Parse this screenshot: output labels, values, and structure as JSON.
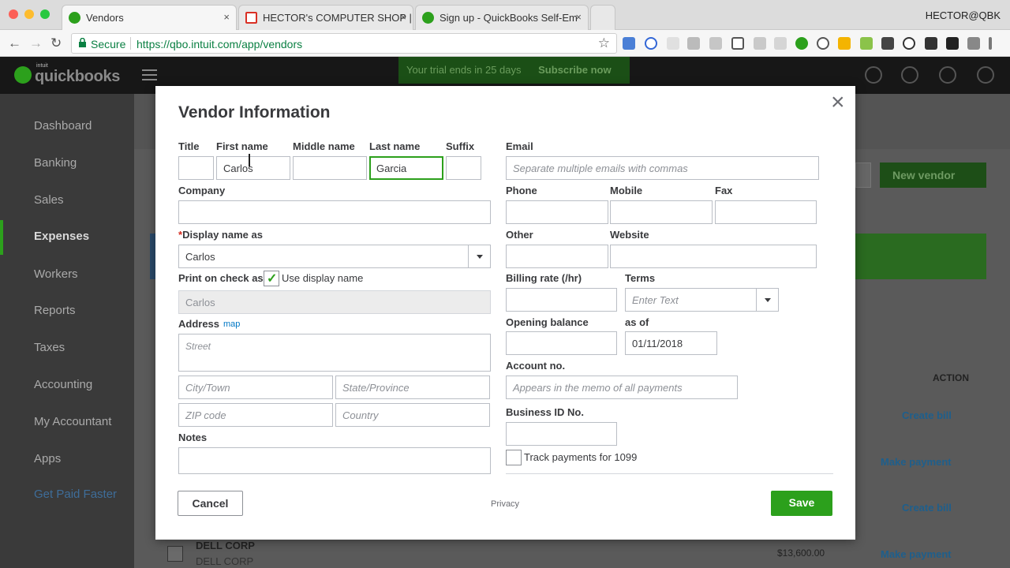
{
  "browser": {
    "tabs": [
      {
        "label": "Vendors",
        "favicon_color": "#2ca01c"
      },
      {
        "label": "HECTOR's COMPUTER SHOP |",
        "favicon_color": "#d93025"
      },
      {
        "label": "Sign up - QuickBooks Self-Em",
        "favicon_color": "#2ca01c"
      }
    ],
    "tab_close": "×",
    "user": "HECTOR@QBK",
    "secure_label": "Secure",
    "url": "https://qbo.intuit.com/app/vendors",
    "back_icon": "←",
    "forward_icon": "→",
    "reload_icon": "↻",
    "star_icon": "☆"
  },
  "app": {
    "logo_small": "intuit",
    "logo": "quickbooks",
    "trial_text": "Your trial ends in 25 days",
    "subscribe_label": "Subscribe now"
  },
  "sidebar": {
    "items": [
      {
        "label": "Dashboard"
      },
      {
        "label": "Banking"
      },
      {
        "label": "Sales"
      },
      {
        "label": "Expenses"
      },
      {
        "label": "Workers"
      },
      {
        "label": "Reports"
      },
      {
        "label": "Taxes"
      },
      {
        "label": "Accounting"
      },
      {
        "label": "My Accountant"
      },
      {
        "label": "Apps"
      },
      {
        "label": "Get Paid Faster"
      }
    ],
    "active_index": 3
  },
  "background": {
    "new_vendor_label": "New vendor",
    "action_header": "ACTION",
    "actions": [
      "Create bill",
      "Make payment",
      "Create bill",
      "Make payment"
    ],
    "vendor_name": "DELL CORP",
    "vendor_sub": "DELL CORP",
    "amount": "$13,600.00"
  },
  "modal": {
    "title": "Vendor Information",
    "close_icon": "×",
    "labels": {
      "title": "Title",
      "first_name": "First name",
      "middle_name": "Middle name",
      "last_name": "Last name",
      "suffix": "Suffix",
      "email": "Email",
      "company": "Company",
      "phone": "Phone",
      "mobile": "Mobile",
      "fax": "Fax",
      "display_name": "Display name as",
      "other": "Other",
      "website": "Website",
      "print_on_check": "Print on check as",
      "use_display_name": "Use display name",
      "billing_rate": "Billing rate (/hr)",
      "terms": "Terms",
      "address": "Address",
      "map_link": "map",
      "opening_balance": "Opening balance",
      "as_of": "as of",
      "account_no": "Account no.",
      "business_id": "Business ID No.",
      "notes": "Notes",
      "track_1099": "Track payments for 1099"
    },
    "values": {
      "title": "",
      "first_name": "Carlos",
      "middle_name": "",
      "last_name": "Garcia",
      "suffix": "",
      "email": "",
      "company": "",
      "phone": "",
      "mobile": "",
      "fax": "",
      "display_name": "Carlos",
      "other": "",
      "website": "",
      "print_on_check": "Carlos",
      "billing_rate": "",
      "terms": "",
      "street": "",
      "city": "",
      "state": "",
      "zip": "",
      "country": "",
      "opening_balance": "",
      "as_of_date": "01/11/2018",
      "account_no": "",
      "business_id": "",
      "notes": ""
    },
    "placeholders": {
      "email": "Separate multiple emails with commas",
      "terms": "Enter Text",
      "street": "Street",
      "city": "City/Town",
      "state": "State/Province",
      "zip": "ZIP code",
      "country": "Country",
      "account_no": "Appears in the memo of all payments"
    },
    "use_display_name_checked": true,
    "track_1099_checked": false,
    "required_mark": "*",
    "check_mark": "✓",
    "cancel_label": "Cancel",
    "privacy_label": "Privacy",
    "save_label": "Save"
  },
  "colors": {
    "brand_green": "#2ca01c",
    "link_blue": "#0077c5",
    "required_red": "#d52b1e"
  }
}
